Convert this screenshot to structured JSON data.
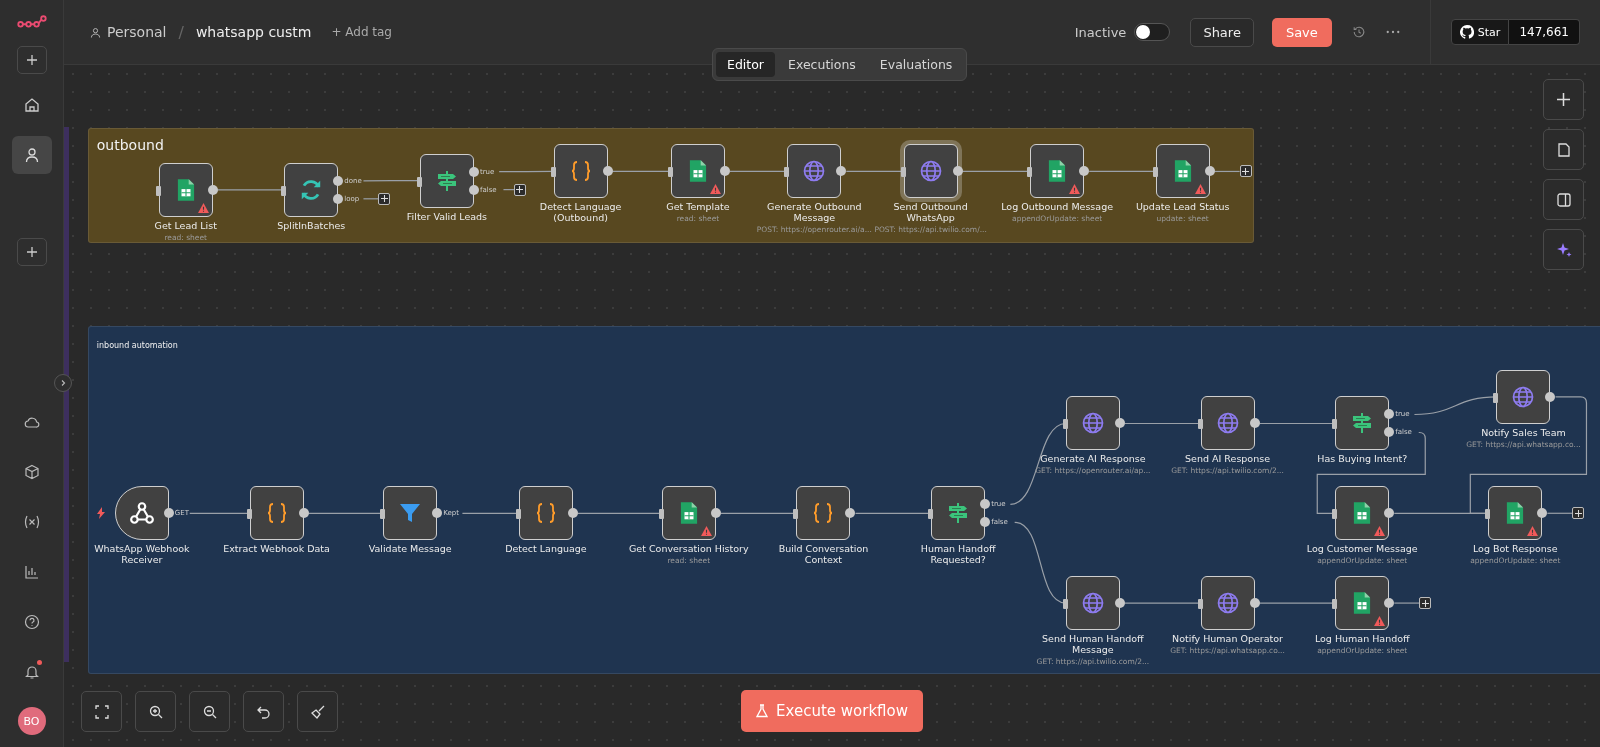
{
  "header": {
    "workspace": "Personal",
    "separator": "/",
    "workflow_name": "whatsapp custm",
    "add_tag": "+ Add tag",
    "status_label": "Inactive",
    "active": false,
    "share": "Share",
    "save": "Save",
    "github_label": "Star",
    "github_count": "147,661"
  },
  "view_tabs": [
    {
      "label": "Editor",
      "selected": true
    },
    {
      "label": "Executions",
      "selected": false
    },
    {
      "label": "Evaluations",
      "selected": false
    }
  ],
  "sidebar": {
    "top": [
      {
        "kind": "home",
        "selected": false
      },
      {
        "kind": "person",
        "selected": true
      }
    ],
    "bottom": [
      {
        "kind": "cloud",
        "badge": false
      },
      {
        "kind": "cube",
        "badge": false
      },
      {
        "kind": "variables",
        "badge": false
      },
      {
        "kind": "chart",
        "badge": false
      },
      {
        "kind": "help",
        "badge": false
      },
      {
        "kind": "bell",
        "badge": true
      }
    ],
    "avatar": "BO"
  },
  "groups": [
    {
      "title": "outbound",
      "color": "#584820"
    },
    {
      "title": "inbound automation",
      "color": "#1f3450"
    }
  ],
  "nodes": [
    {
      "name": "Get Lead List",
      "subtitle": "read: sheet",
      "kind": "sheet",
      "warning": true,
      "selected": false
    },
    {
      "name": "SplitInBatches",
      "kind": "loop",
      "warning": false,
      "selected": false,
      "outputs": [
        {
          "label": "done"
        },
        {
          "label": "loop",
          "open_end": true
        }
      ]
    },
    {
      "name": "Filter Valid Leads",
      "kind": "if",
      "warning": false,
      "selected": false,
      "outputs": [
        {
          "label": "true"
        },
        {
          "label": "false",
          "open_end": true
        }
      ]
    },
    {
      "name": "Detect Language (Outbound)",
      "kind": "code",
      "warning": false,
      "selected": false
    },
    {
      "name": "Get Template",
      "subtitle": "read: sheet",
      "kind": "sheet",
      "warning": true,
      "selected": false
    },
    {
      "name": "Generate Outbound Message",
      "subtitle": "POST: https://openrouter.ai/a...",
      "kind": "http",
      "warning": false,
      "selected": false
    },
    {
      "name": "Send Outbound WhatsApp",
      "subtitle": "POST: https://api.twilio.com/...",
      "kind": "http",
      "warning": false,
      "selected": true
    },
    {
      "name": "Log Outbound Message",
      "subtitle": "appendOrUpdate: sheet",
      "kind": "sheet",
      "warning": true,
      "selected": false
    },
    {
      "name": "Update Lead Status",
      "subtitle": "update: sheet",
      "kind": "sheet",
      "warning": true,
      "selected": false,
      "outputs": [
        {
          "open_end": true
        }
      ]
    },
    {
      "name": "WhatsApp Webhook Receiver",
      "kind": "webhook",
      "warning": false,
      "selected": false,
      "outputs": [
        {
          "label": "GET"
        }
      ]
    },
    {
      "name": "Extract Webhook Data",
      "kind": "code",
      "warning": false,
      "selected": false
    },
    {
      "name": "Validate Message",
      "kind": "filter",
      "warning": false,
      "selected": false,
      "outputs": [
        {
          "label": "Kept"
        }
      ]
    },
    {
      "name": "Detect Language",
      "kind": "code",
      "warning": false,
      "selected": false
    },
    {
      "name": "Get Conversation History",
      "subtitle": "read: sheet",
      "kind": "sheet",
      "warning": true,
      "selected": false
    },
    {
      "name": "Build Conversation Context",
      "kind": "code",
      "warning": false,
      "selected": false
    },
    {
      "name": "Human Handoff Requested?",
      "kind": "if",
      "warning": false,
      "selected": false,
      "outputs": [
        {
          "label": "true"
        },
        {
          "label": "false"
        }
      ]
    },
    {
      "name": "Generate AI Response",
      "subtitle": "GET: https://openrouter.ai/ap...",
      "kind": "http",
      "warning": false,
      "selected": false
    },
    {
      "name": "Send AI Response",
      "subtitle": "GET: https://api.twilio.com/2...",
      "kind": "http",
      "warning": false,
      "selected": false
    },
    {
      "name": "Has Buying Intent?",
      "kind": "if",
      "warning": false,
      "selected": false,
      "outputs": [
        {
          "label": "true"
        },
        {
          "label": "false"
        }
      ]
    },
    {
      "name": "Notify Sales Team",
      "subtitle": "GET: https://api.whatsapp.co...",
      "kind": "http",
      "warning": false,
      "selected": false
    },
    {
      "name": "Log Customer Message",
      "subtitle": "appendOrUpdate: sheet",
      "kind": "sheet",
      "warning": true,
      "selected": false
    },
    {
      "name": "Log Bot Response",
      "subtitle": "appendOrUpdate: sheet",
      "kind": "sheet",
      "warning": true,
      "selected": false,
      "outputs": [
        {
          "open_end": true
        }
      ]
    },
    {
      "name": "Send Human Handoff Message",
      "subtitle": "GET: https://api.twilio.com/2...",
      "kind": "http",
      "warning": false,
      "selected": false
    },
    {
      "name": "Notify Human Operator",
      "subtitle": "GET: https://api.whatsapp.co...",
      "kind": "http",
      "warning": false,
      "selected": false
    },
    {
      "name": "Log Human Handoff",
      "subtitle": "appendOrUpdate: sheet",
      "kind": "sheet",
      "warning": true,
      "selected": false,
      "outputs": [
        {
          "open_end": true
        }
      ]
    }
  ],
  "execute_button": "Execute workflow"
}
